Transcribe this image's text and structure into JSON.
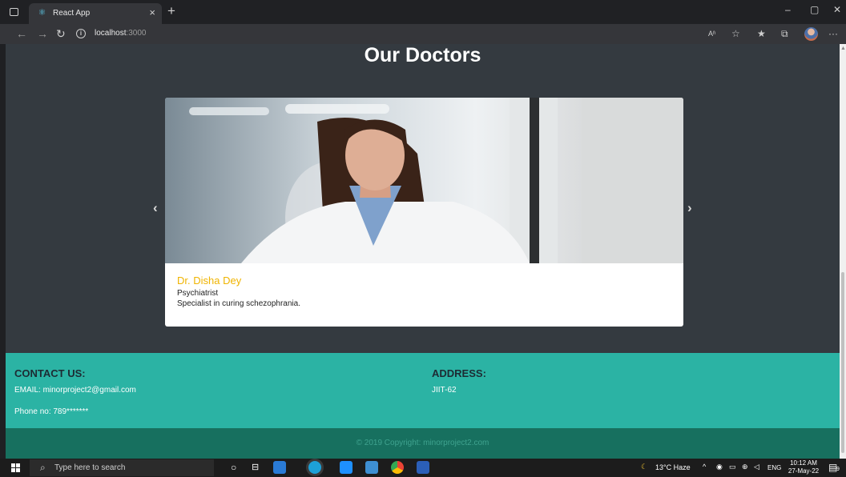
{
  "browser": {
    "tab_title": "React App",
    "close_glyph": "×",
    "new_tab_glyph": "+",
    "url_host": "localhost",
    "url_port": ":3000",
    "window_controls": {
      "minimize": "–",
      "maximize": "▢",
      "close": "✕"
    },
    "toolbar_icons": [
      "read-aloud-icon",
      "favorites-add-icon",
      "favorites-icon",
      "collections-icon",
      "profile-avatar",
      "more-icon"
    ],
    "toolbar_glyphs": {
      "read_aloud": "Aʱ",
      "favorite_add": "☆",
      "favorites": "★",
      "collections": "⧉",
      "more": "···"
    }
  },
  "page": {
    "section_title": "Our Doctors",
    "carousel": {
      "prev_glyph": "‹",
      "next_glyph": "›",
      "slide": {
        "name": "Dr. Disha Dey",
        "role": "Psychiatrist",
        "description": "Specialist in curing schezophrania."
      }
    },
    "footer": {
      "contact_heading": "CONTACT US:",
      "email": "EMAIL: minorproject2@gmail.com",
      "phone": "Phone no: 789*******",
      "address_heading": "ADDRESS:",
      "address": "JIIT-62",
      "copyright": "© 2019 Copyright: minorproject2.com"
    }
  },
  "taskbar": {
    "search_placeholder": "Type here to search",
    "weather": "13°C  Haze",
    "language": "ENG",
    "time": "10:12 AM",
    "date": "27-May-22",
    "notification_count": "9"
  },
  "colors": {
    "page_bg": "#343a40",
    "footer_bg": "#2bb3a4",
    "copyright_bg": "#17705f",
    "doctor_name": "#f0b400"
  }
}
